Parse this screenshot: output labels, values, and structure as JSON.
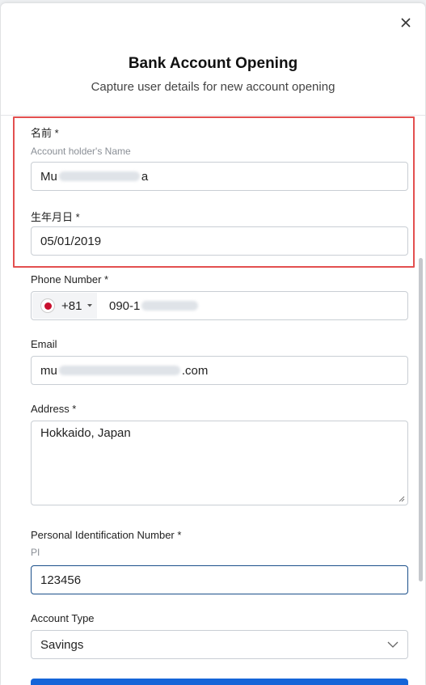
{
  "header": {
    "title": "Bank Account Opening",
    "subtitle": "Capture user details for new account opening",
    "close_icon": "close-icon"
  },
  "fields": {
    "name": {
      "label": "名前 *",
      "hint": "Account holder's Name",
      "value_prefix": "Mu",
      "value_suffix": "a"
    },
    "dob": {
      "label": "生年月日 *",
      "value": "05/01/2019"
    },
    "phone": {
      "label": "Phone Number *",
      "country_code": "+81",
      "value_prefix": "090-1",
      "flag_icon": "japan-flag-icon"
    },
    "email": {
      "label": "Email",
      "value_prefix": "mu",
      "value_suffix": ".com"
    },
    "address": {
      "label": "Address *",
      "value": "Hokkaido, Japan"
    },
    "pin": {
      "label": "Personal Identification Number *",
      "hint": "PI",
      "value": "123456"
    },
    "account_type": {
      "label": "Account Type",
      "value": "Savings"
    }
  },
  "colors": {
    "highlight": "#e35050",
    "accent": "#1565d8"
  }
}
